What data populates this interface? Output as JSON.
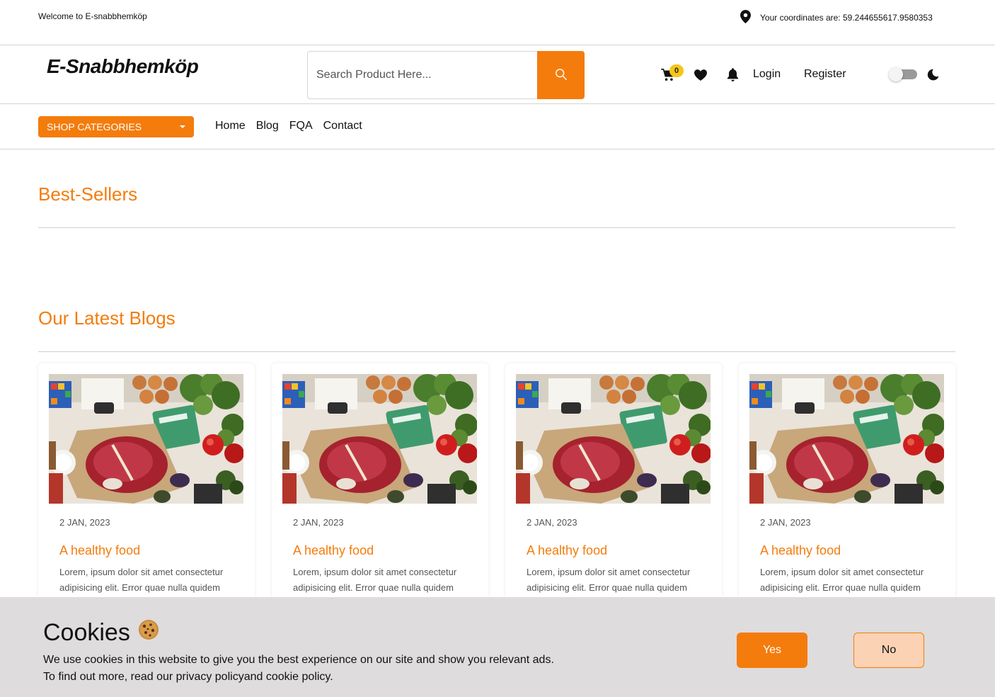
{
  "topbar": {
    "welcome": "Welcome to E-snabbhemköp",
    "coordinates_text": "Your coordinates are: 59.244655617.9580353",
    "location_icon": "map-pin-icon"
  },
  "header": {
    "logo_text": "E-Snabbhemköp",
    "search_placeholder": "Search Product Here...",
    "search_icon": "search-icon",
    "cart_icon": "cart-icon",
    "cart_count": "0",
    "wishlist_icon": "heart-icon",
    "notifications_icon": "bell-icon",
    "login_label": "Login",
    "register_label": "Register",
    "theme_toggle_icon": "toggle-icon",
    "dark_mode_icon": "moon-icon"
  },
  "navbar": {
    "shop_categories_label": "SHOP CATEGORIES",
    "links": [
      "Home",
      "Blog",
      "FQA",
      "Contact"
    ]
  },
  "sections": {
    "best_sellers_title": "Best-Sellers",
    "latest_blogs_title": "Our Latest Blogs"
  },
  "blogs": [
    {
      "date": "2 JAN, 2023",
      "title": "A healthy food",
      "excerpt": "Lorem, ipsum dolor sit amet consectetur adipisicing elit. Error quae nulla quidem"
    },
    {
      "date": "2 JAN, 2023",
      "title": "A healthy food",
      "excerpt": "Lorem, ipsum dolor sit amet consectetur adipisicing elit. Error quae nulla quidem"
    },
    {
      "date": "2 JAN, 2023",
      "title": "A healthy food",
      "excerpt": "Lorem, ipsum dolor sit amet consectetur adipisicing elit. Error quae nulla quidem"
    },
    {
      "date": "2 JAN, 2023",
      "title": "A healthy food",
      "excerpt": "Lorem, ipsum dolor sit amet consectetur adipisicing elit. Error quae nulla quidem"
    }
  ],
  "cookie_banner": {
    "title": "Cookies",
    "cookie_icon": "cookie-icon",
    "line1": "We use cookies in this website to give you the best experience on our site and show you relevant ads.",
    "line2": "To find out more, read our privacy policyand cookie policy.",
    "yes_label": "Yes",
    "no_label": "No"
  },
  "colors": {
    "accent": "#f47c0c",
    "badge": "#f6c617",
    "cookie_bg": "#dedcdd",
    "no_button_bg": "#fbd2b4"
  }
}
